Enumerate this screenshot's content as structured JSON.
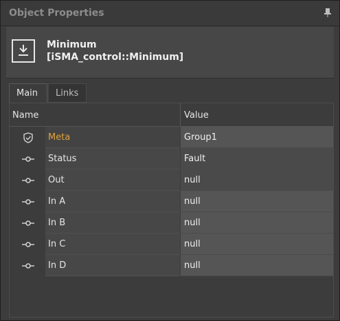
{
  "panel": {
    "title": "Object Properties",
    "pin_icon": "pin-icon"
  },
  "object": {
    "name": "Minimum",
    "type": "[iSMA_control::Minimum]",
    "icon": "download-tray-icon"
  },
  "tabs": [
    {
      "label": "Main",
      "active": true
    },
    {
      "label": "Links",
      "active": false
    }
  ],
  "grid": {
    "columns": [
      "Name",
      "Value"
    ],
    "rows": [
      {
        "name": "Meta",
        "value": "Group1",
        "icon": "shield-check-icon"
      },
      {
        "name": "Status",
        "value": "Fault",
        "icon": "slot-connector-icon"
      },
      {
        "name": "Out",
        "value": "null",
        "icon": "slot-connector-icon"
      },
      {
        "name": "In A",
        "value": "null",
        "icon": "slot-connector-icon"
      },
      {
        "name": "In B",
        "value": "null",
        "icon": "slot-connector-icon"
      },
      {
        "name": "In C",
        "value": "null",
        "icon": "slot-connector-icon"
      },
      {
        "name": "In D",
        "value": "null",
        "icon": "slot-connector-icon"
      }
    ]
  },
  "colors": {
    "accent_meta": "#e0a33a",
    "panel_bg": "#3c3c3c"
  }
}
